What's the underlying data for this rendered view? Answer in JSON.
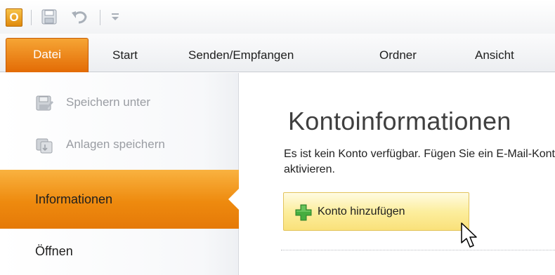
{
  "quick_access": {
    "app_letter": "O",
    "icons": [
      "outlook-app-icon",
      "save-icon",
      "undo-icon",
      "customize-toolbar-icon"
    ]
  },
  "ribbon": {
    "tabs": [
      {
        "label": "Datei",
        "active": true
      },
      {
        "label": "Start"
      },
      {
        "label": "Senden/Empfangen"
      },
      {
        "label": "Ordner"
      },
      {
        "label": "Ansicht"
      }
    ]
  },
  "nav": {
    "items": [
      {
        "label": "Speichern unter",
        "icon": "save-as-icon",
        "enabled": false
      },
      {
        "label": "Anlagen speichern",
        "icon": "save-attachments-icon",
        "enabled": false
      },
      {
        "label": "Informationen",
        "selected": true
      },
      {
        "label": "Öffnen"
      }
    ]
  },
  "content": {
    "title": "Kontoinformationen",
    "description_line1": "Es ist kein Konto verfügbar. Fügen Sie ein E-Mail-Konto hinzu, um",
    "description_line2": "aktivieren.",
    "add_account_label": "Konto hinzufügen",
    "add_account_icon": "green-plus-icon"
  },
  "colors": {
    "accent_orange": "#e8790a",
    "button_hover_yellow": "#fae17a",
    "plus_green": "#3da23a"
  }
}
